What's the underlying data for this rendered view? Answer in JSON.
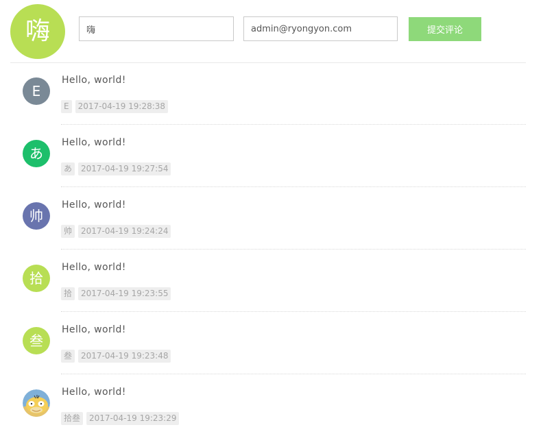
{
  "form": {
    "avatar_char": "嗨",
    "avatar_color": "#b8de54",
    "name_value": "嗨",
    "email_value": "admin@ryongyon.com",
    "submit_label": "提交评论",
    "submit_color": "#8ed97a"
  },
  "comments": [
    {
      "avatar_char": "E",
      "avatar_color": "#7a8996",
      "text": "Hello, world!",
      "author": "E",
      "time": "2017-04-19 19:28:38"
    },
    {
      "avatar_char": "あ",
      "avatar_color": "#1dbf6b",
      "text": "Hello, world!",
      "author": "あ",
      "time": "2017-04-19 19:27:54"
    },
    {
      "avatar_char": "帅",
      "avatar_color": "#6974ae",
      "text": "Hello, world!",
      "author": "帅",
      "time": "2017-04-19 19:24:24"
    },
    {
      "avatar_char": "拾",
      "avatar_color": "#b8de54",
      "text": "Hello, world!",
      "author": "拾",
      "time": "2017-04-19 19:23:55"
    },
    {
      "avatar_char": "叁",
      "avatar_color": "#b8de54",
      "text": "Hello, world!",
      "author": "叁",
      "time": "2017-04-19 19:23:48"
    },
    {
      "avatar_icon": "psyduck-avatar-image",
      "text": "Hello, world!",
      "author": "拾叁",
      "time": "2017-04-19 19:23:29"
    }
  ]
}
